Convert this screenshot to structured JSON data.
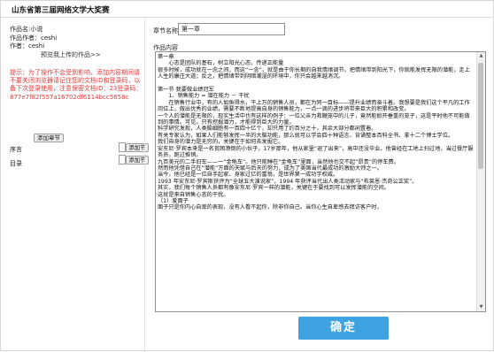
{
  "header": {
    "title": "山东省第三届网络文学大奖赛"
  },
  "sidebar": {
    "work_name": "作品名:小说",
    "author": "作品作者：ceshi",
    "writer": "作者：ceshi",
    "preview_link": "预览我上传的作品>>",
    "warning": "提示：为了操作不会受到影响，添加内容期间请不要关闭浏览器请记住您的文档ID和登录码，以备下次登录使用，注意保密文档ID：23登录码：877e7f82f557a16702df6114bcc5658c",
    "add_chapter": "添加章节",
    "preface_label": "序言",
    "catalog_label": "目录",
    "add_button": "添加节",
    "scroll_up": "▲",
    "scroll_down": "▼"
  },
  "main": {
    "chapter_name_label": "章节名称",
    "chapter_name_value": "第一章",
    "content_label": "作品内容",
    "content_lines": [
      "第一章",
      "　　心态是团队的基石，树立阳光心态，传递正能量",
      "很多时候，成功就在一念之间，而这“一念”，就是由于你长期的自我情绪调节。把情绪带到阳光下，你就能发挥无限的潜能，走上人生的康庄大道；反之，把情绪带到阴暗潮湿的环境中，你只会越来越消沉。",
      "",
      "第一节 我要做业绩冠军",
      "　　1、销售能力 = 潜在能力 － 干扰",
      "　　在销售行业中，有的人如鱼得水，干上万的销售人员，都在为同一目标——提升业绩而奋斗着。我想要是我们这个平凡的工作岗位上，做出优秀的业绩，需要不断地提高自身的销售能力，一点一滴的进步将带来巨大的积累和改变。",
      "一个人的潜能是无限的，现实生活中也有这样的例子：一位父亲为救鞭笼中的儿子，竟然能掀开垂重的笼子，这是平时他不可能做到的事情。可见，只有挖掘潜力，才能得到巨大的力量。",
      "科学研究发现，人类脑细胞有一百四十亿个，却只用了约百分之十，其余大部分都闲置着。",
      "有关专家认为，如果人们能够发挥一半的大脑功能，那么就可以学会四十种语言、背诵整本百科全书、拿十二个博士学位。",
      "我们自身的潜力是无穷的，关键在于如何去发掘它。",
      "安东尼·罗宾本来是一名贫困潦倒的小伙子，17岁那年，他从家里“退了出来”，高中还没毕业。他曾经在工地上扫过地，当过餐厅服务员，跑过推销。",
      "九百美元的二手旧车——一“金龟车”。他只能睡在“金龟车”里面，当然他也交不起“昂贵”的停车费。",
      "然而他凭借自己在“潜能”方面的天赋与后天的努力，成为了美国当代最成功的激励大师之一。",
      "当今，他已经是一位自手起家、身家过亿的富翁，是世界第一成功学权威。",
      "1993 年安东尼·罗宾斯获评为“全球五大演说家”，1994 年获评当代出人类活动家与“布莱恩·杰奇公正奖”。",
      "其实，我们每个销售人员都有像安东尼·罗宾一样的潜能，关键在于要找到可以发挥潜能的空间。",
      "这就是来自销售心态的干扰。",
      "（1）爱面子",
      "面子只是你内心自卑的表现，没有人看不起你，除非你自己。当你心生自卑感去拜访客户时，"
    ],
    "scroll_up": "▲",
    "scroll_down": "▼",
    "confirm_label": "确定"
  }
}
